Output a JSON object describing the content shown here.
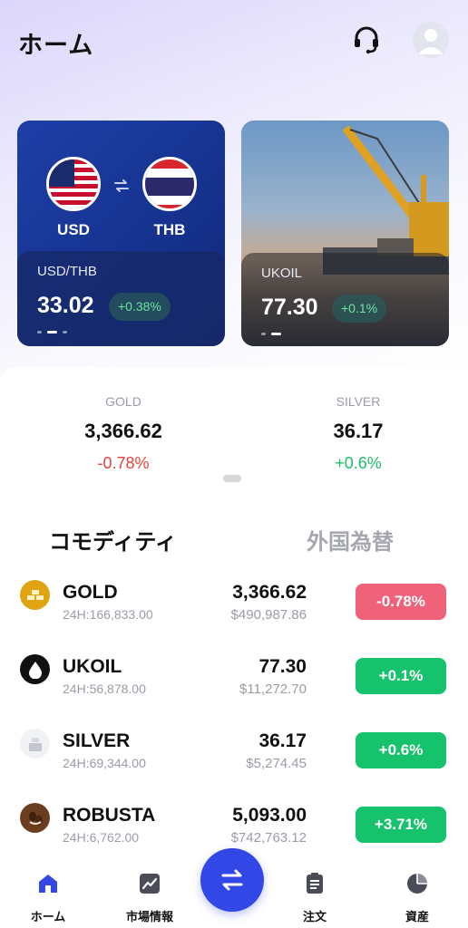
{
  "header": {
    "title": "ホーム",
    "support_icon": "headset-icon",
    "avatar_icon": "user-avatar-icon"
  },
  "carousel": [
    {
      "base": "USD",
      "quote": "THB",
      "symbol": "USD/THB",
      "price": "33.02",
      "change": "+0.38%"
    },
    {
      "symbol": "UKOIL",
      "price": "77.30",
      "change": "+0.1%"
    }
  ],
  "ticker": [
    {
      "name": "GOLD",
      "price": "3,366.62",
      "change": "-0.78%"
    },
    {
      "name": "SILVER",
      "price": "36.17",
      "change": "+0.6%"
    }
  ],
  "tabs": [
    {
      "label": "コモディティ",
      "active": true
    },
    {
      "label": "外国為替",
      "active": false
    }
  ],
  "list": [
    {
      "name": "GOLD",
      "volume": "24H:166,833.00",
      "price": "3,366.62",
      "usd": "$490,987.86",
      "change": "-0.78%"
    },
    {
      "name": "UKOIL",
      "volume": "24H:56,878.00",
      "price": "77.30",
      "usd": "$11,272.70",
      "change": "+0.1%"
    },
    {
      "name": "SILVER",
      "volume": "24H:69,344.00",
      "price": "36.17",
      "usd": "$5,274.45",
      "change": "+0.6%"
    },
    {
      "name": "ROBUSTA",
      "volume": "24H:6,762.00",
      "price": "5,093.00",
      "usd": "$742,763.12",
      "change": "+3.71%"
    }
  ],
  "nav": [
    {
      "label": "ホーム",
      "icon": "home-icon",
      "active": true
    },
    {
      "label": "市場情報",
      "icon": "chart-icon",
      "active": false
    },
    {
      "label": "",
      "icon": "swap-icon",
      "active": false
    },
    {
      "label": "注文",
      "icon": "clipboard-icon",
      "active": false
    },
    {
      "label": "資産",
      "icon": "pie-chart-icon",
      "active": false
    }
  ],
  "colors": {
    "accent": "#3247e6",
    "positive": "#17c26d",
    "negative": "#f0627a",
    "fx_card": "#173594"
  }
}
